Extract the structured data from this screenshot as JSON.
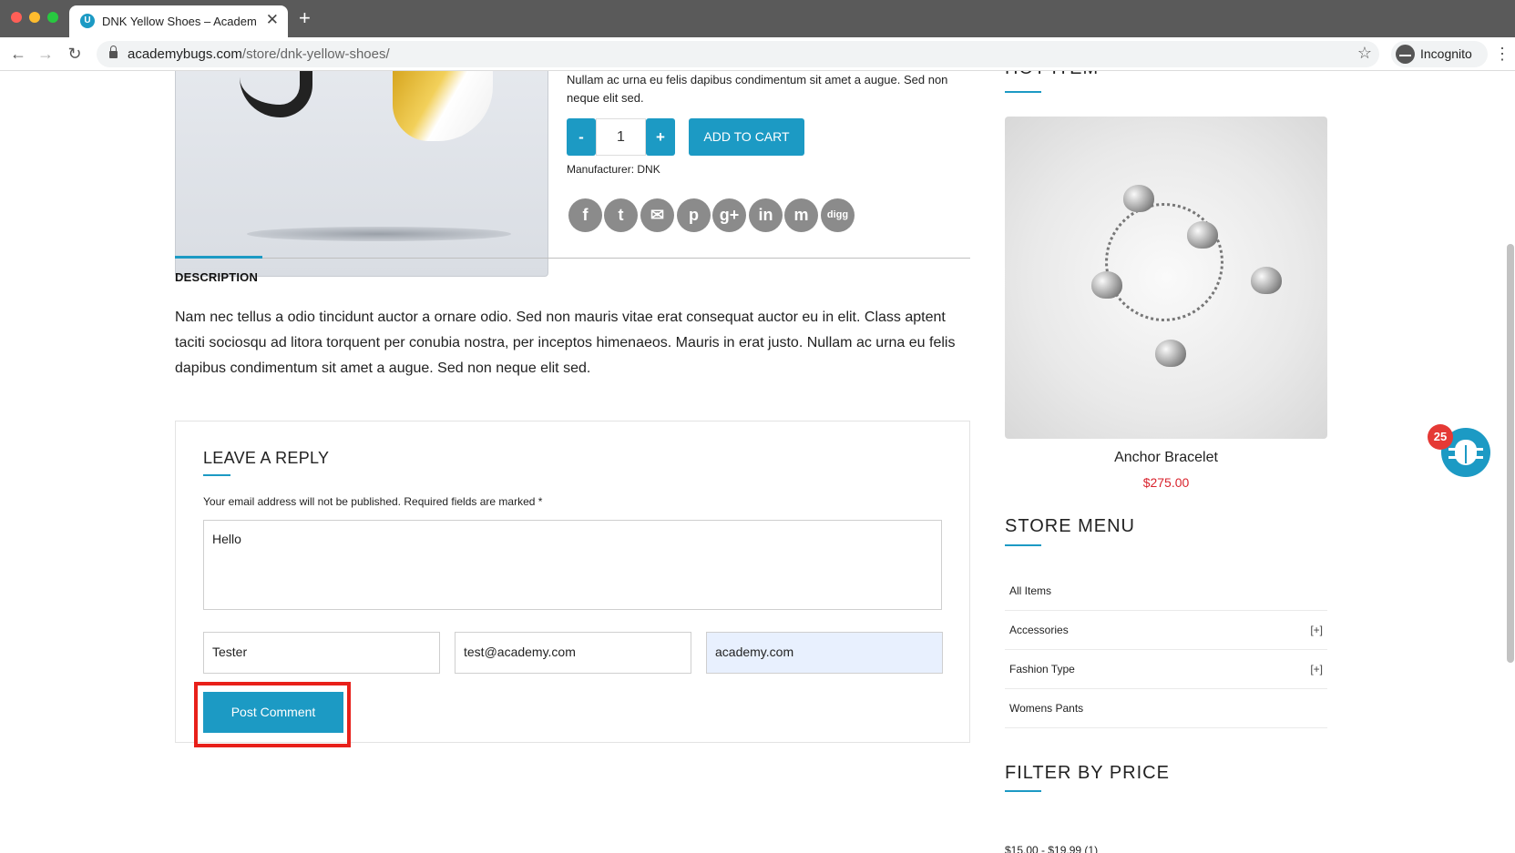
{
  "browser": {
    "tab_title": "DNK Yellow Shoes – AcademyBugs",
    "tab_close": "✕",
    "new_tab": "+",
    "url_domain": "academybugs.com",
    "url_path": "/store/dnk-yellow-shoes/",
    "profile_label": "Incognito",
    "icons": [
      "back-arrow-icon",
      "forward-arrow-icon",
      "reload-icon",
      "lock-icon",
      "star-icon",
      "incognito-icon",
      "menu-dots-icon"
    ]
  },
  "product": {
    "description": "Nullam ac urna eu felis dapibus condimentum sit amet a augue. Sed non neque elit sed.",
    "qty_minus": "-",
    "quantity": "1",
    "qty_plus": "+",
    "add_to_cart": "ADD TO CART",
    "manufacturer_label": "Manufacturer:",
    "manufacturer_value": "DNK",
    "social": [
      {
        "name": "facebook-icon",
        "glyph": "f"
      },
      {
        "name": "twitter-icon",
        "glyph": "t"
      },
      {
        "name": "email-icon",
        "glyph": "✉"
      },
      {
        "name": "pinterest-icon",
        "glyph": "p"
      },
      {
        "name": "google-plus-icon",
        "glyph": "g+"
      },
      {
        "name": "linkedin-icon",
        "glyph": "in"
      },
      {
        "name": "myspace-icon",
        "glyph": "m"
      },
      {
        "name": "digg-icon",
        "glyph": "digg"
      }
    ]
  },
  "tabs": {
    "description_heading": "DESCRIPTION",
    "description_text": "Nam nec tellus a odio tincidunt auctor a ornare odio. Sed non mauris vitae erat consequat auctor eu in elit. Class aptent taciti sociosqu ad litora torquent per conubia nostra, per inceptos himenaeos. Mauris in erat justo. Nullam ac urna eu felis dapibus condimentum sit amet a augue. Sed non neque elit sed."
  },
  "reply": {
    "title": "LEAVE A REPLY",
    "note": "Your email address will not be published. Required fields are marked *",
    "comment": "Hello",
    "name": "Tester",
    "email": "test@academy.com",
    "website": "academy.com",
    "submit": "Post Comment"
  },
  "sidebar": {
    "hot_item_heading": "HOT ITEM",
    "hot_item_name": "Anchor Bracelet",
    "hot_item_price": "$275.00",
    "store_menu_heading": "STORE MENU",
    "menu": [
      {
        "label": "All Items",
        "expand": ""
      },
      {
        "label": "Accessories",
        "expand": "[+]"
      },
      {
        "label": "Fashion Type",
        "expand": "[+]"
      },
      {
        "label": "Womens Pants",
        "expand": ""
      }
    ],
    "filter_heading": "FILTER BY PRICE",
    "filter_first": "$15.00 - $19.99 (1)"
  },
  "widget": {
    "bug_count": "25"
  },
  "colors": {
    "accent": "#1c9ac4",
    "price": "#d9232d",
    "highlight": "#e8201a"
  }
}
